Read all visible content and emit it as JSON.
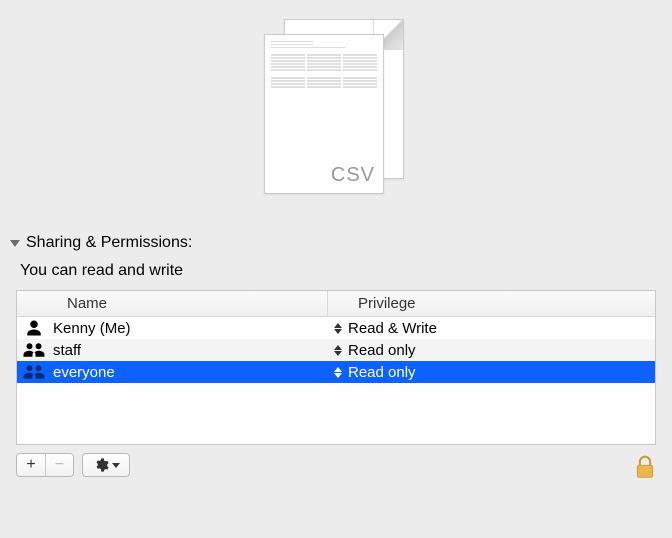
{
  "file_type_label": "CSV",
  "section": {
    "title": "Sharing & Permissions:",
    "status": "You can read and write"
  },
  "table": {
    "headers": {
      "name": "Name",
      "privilege": "Privilege"
    },
    "rows": [
      {
        "icon": "person",
        "name": "Kenny (Me)",
        "privilege": "Read & Write",
        "selected": false
      },
      {
        "icon": "group",
        "name": "staff",
        "privilege": "Read only",
        "selected": false
      },
      {
        "icon": "group",
        "name": "everyone",
        "privilege": "Read only",
        "selected": true
      }
    ]
  },
  "toolbar": {
    "add": "+",
    "remove": "−"
  }
}
